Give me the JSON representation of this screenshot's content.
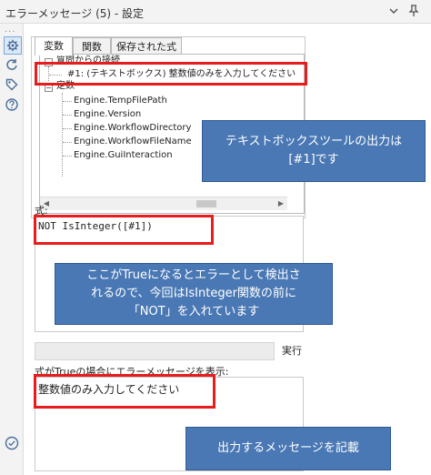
{
  "window": {
    "title": "エラーメッセージ (5) - 設定",
    "dropdown_icon": "chevron-down-icon",
    "pin_icon": "pin-icon"
  },
  "leftbar": {
    "more_label": "...",
    "icons": [
      "gear-icon",
      "refresh-icon",
      "tag-icon",
      "help-icon"
    ]
  },
  "tabs": [
    {
      "label": "変数",
      "active": true
    },
    {
      "label": "関数",
      "active": false
    },
    {
      "label": "保存された式",
      "active": false
    }
  ],
  "tree": {
    "connection_header": "質問からの接続",
    "connection_item": "#1: (テキストボックス) 整数値のみを入力してください",
    "constants_header": "定数",
    "constants": [
      "Engine.TempFilePath",
      "Engine.Version",
      "Engine.WorkflowDirectory",
      "Engine.WorkflowFileName",
      "Engine.GuiInteraction"
    ]
  },
  "expression": {
    "label": "式:",
    "value": "NOT IsInteger([#1])"
  },
  "execute": {
    "button": "実行"
  },
  "message": {
    "label": "式がTrueの場合にエラーメッセージを表示:",
    "value": "整数値のみ入力してください"
  },
  "callouts": {
    "callout1": "テキストボックスツールの出力は\n[#1]です",
    "callout2": "ここがTrueになるとエラーとして検出さ\nれるので、今回はIsInteger関数の前に\n「NOT」を入れています",
    "callout3": "出力するメッセージを記載"
  },
  "colors": {
    "highlight_red": "#e81c1c",
    "callout_blue": "#4a78b4"
  }
}
